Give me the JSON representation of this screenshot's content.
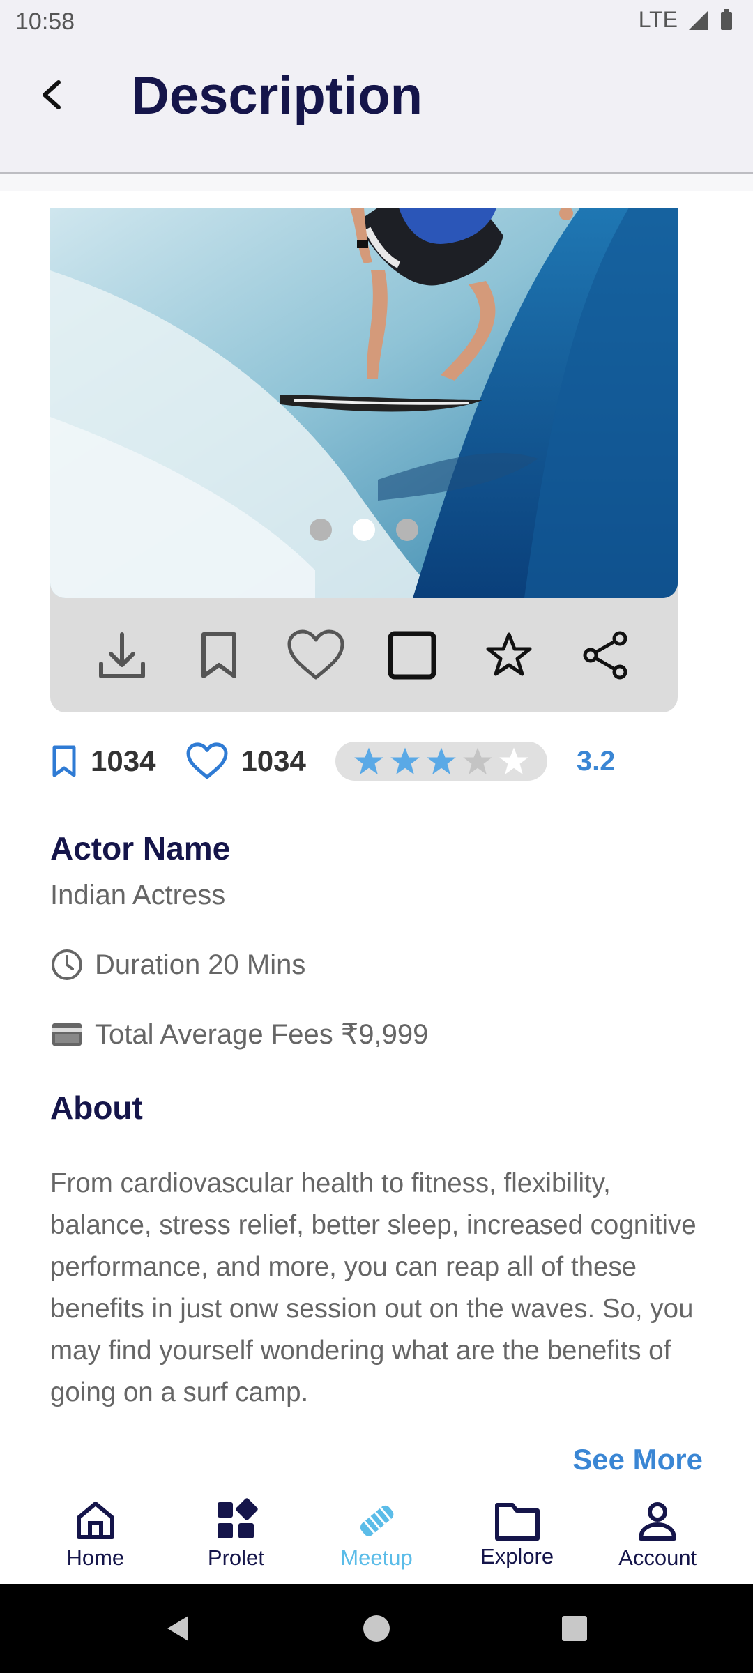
{
  "status_bar": {
    "time": "10:58",
    "network": "LTE"
  },
  "header": {
    "title": "Description"
  },
  "carousel": {
    "page_count": 3,
    "active_index": 1
  },
  "actions": [
    "download",
    "bookmark",
    "like",
    "select",
    "favorite",
    "share"
  ],
  "stats": {
    "bookmarks": "1034",
    "likes": "1034",
    "rating_value": "3.2",
    "rating": 3
  },
  "details": {
    "actor_name": "Actor Name",
    "actor_role": "Indian Actress",
    "duration": "Duration 20 Mins",
    "fees": "Total Average Fees ₹9,999"
  },
  "about": {
    "title": "About",
    "text": "From cardiovascular health to fitness, flexibility, balance, stress relief, better sleep, increased cognitive performance, and more, you can reap all of these benefits in just onw session out on the waves. So, you may find yourself wondering what are the benefits of going on a surf camp.",
    "see_more": "See More"
  },
  "nav": {
    "items": [
      {
        "label": "Home",
        "icon": "home-icon"
      },
      {
        "label": "Prolet",
        "icon": "grid-icon"
      },
      {
        "label": "Meetup",
        "icon": "handshake-icon"
      },
      {
        "label": "Explore",
        "icon": "folder-icon"
      },
      {
        "label": "Account",
        "icon": "person-icon"
      }
    ],
    "active": "Meetup"
  },
  "colors": {
    "primary": "#15154a",
    "accent": "#3a86d4",
    "active_nav": "#5bbce8",
    "star_filled": "#5aa9e6"
  }
}
